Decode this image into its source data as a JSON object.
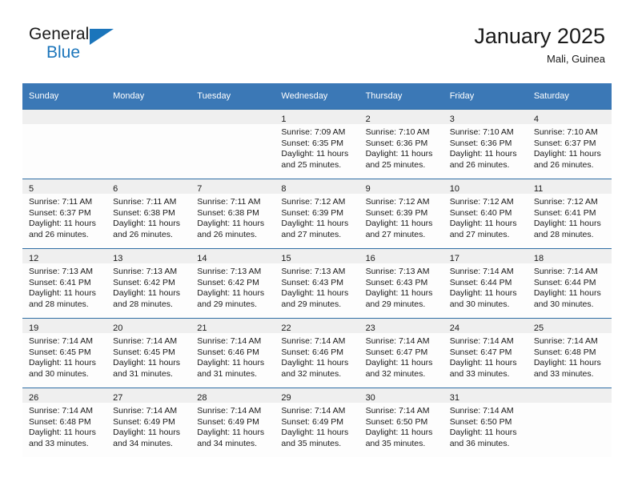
{
  "brand": {
    "word_top": "General",
    "word_bottom": "Blue",
    "logo_icon": "triangle-logo-icon",
    "accent_color": "#1b75bb"
  },
  "header": {
    "title": "January 2025",
    "subtitle": "Mali, Guinea"
  },
  "theme": {
    "header_blue": "#3b78b6",
    "header_rule": "#2e6da4",
    "daynum_band": "#efefef",
    "cell_bg": "#fdfdfd",
    "text": "#1a1a1a"
  },
  "weekday_headers": [
    "Sunday",
    "Monday",
    "Tuesday",
    "Wednesday",
    "Thursday",
    "Friday",
    "Saturday"
  ],
  "labels": {
    "sunrise": "Sunrise:",
    "sunset": "Sunset:",
    "daylight": "Daylight:"
  },
  "weeks": [
    [
      {
        "day": "",
        "l1": "",
        "l2": "",
        "l3": "",
        "l4": ""
      },
      {
        "day": "",
        "l1": "",
        "l2": "",
        "l3": "",
        "l4": ""
      },
      {
        "day": "",
        "l1": "",
        "l2": "",
        "l3": "",
        "l4": ""
      },
      {
        "day": "1",
        "l1": "Sunrise: 7:09 AM",
        "l2": "Sunset: 6:35 PM",
        "l3": "Daylight: 11 hours",
        "l4": "and 25 minutes."
      },
      {
        "day": "2",
        "l1": "Sunrise: 7:10 AM",
        "l2": "Sunset: 6:36 PM",
        "l3": "Daylight: 11 hours",
        "l4": "and 25 minutes."
      },
      {
        "day": "3",
        "l1": "Sunrise: 7:10 AM",
        "l2": "Sunset: 6:36 PM",
        "l3": "Daylight: 11 hours",
        "l4": "and 26 minutes."
      },
      {
        "day": "4",
        "l1": "Sunrise: 7:10 AM",
        "l2": "Sunset: 6:37 PM",
        "l3": "Daylight: 11 hours",
        "l4": "and 26 minutes."
      }
    ],
    [
      {
        "day": "5",
        "l1": "Sunrise: 7:11 AM",
        "l2": "Sunset: 6:37 PM",
        "l3": "Daylight: 11 hours",
        "l4": "and 26 minutes."
      },
      {
        "day": "6",
        "l1": "Sunrise: 7:11 AM",
        "l2": "Sunset: 6:38 PM",
        "l3": "Daylight: 11 hours",
        "l4": "and 26 minutes."
      },
      {
        "day": "7",
        "l1": "Sunrise: 7:11 AM",
        "l2": "Sunset: 6:38 PM",
        "l3": "Daylight: 11 hours",
        "l4": "and 26 minutes."
      },
      {
        "day": "8",
        "l1": "Sunrise: 7:12 AM",
        "l2": "Sunset: 6:39 PM",
        "l3": "Daylight: 11 hours",
        "l4": "and 27 minutes."
      },
      {
        "day": "9",
        "l1": "Sunrise: 7:12 AM",
        "l2": "Sunset: 6:39 PM",
        "l3": "Daylight: 11 hours",
        "l4": "and 27 minutes."
      },
      {
        "day": "10",
        "l1": "Sunrise: 7:12 AM",
        "l2": "Sunset: 6:40 PM",
        "l3": "Daylight: 11 hours",
        "l4": "and 27 minutes."
      },
      {
        "day": "11",
        "l1": "Sunrise: 7:12 AM",
        "l2": "Sunset: 6:41 PM",
        "l3": "Daylight: 11 hours",
        "l4": "and 28 minutes."
      }
    ],
    [
      {
        "day": "12",
        "l1": "Sunrise: 7:13 AM",
        "l2": "Sunset: 6:41 PM",
        "l3": "Daylight: 11 hours",
        "l4": "and 28 minutes."
      },
      {
        "day": "13",
        "l1": "Sunrise: 7:13 AM",
        "l2": "Sunset: 6:42 PM",
        "l3": "Daylight: 11 hours",
        "l4": "and 28 minutes."
      },
      {
        "day": "14",
        "l1": "Sunrise: 7:13 AM",
        "l2": "Sunset: 6:42 PM",
        "l3": "Daylight: 11 hours",
        "l4": "and 29 minutes."
      },
      {
        "day": "15",
        "l1": "Sunrise: 7:13 AM",
        "l2": "Sunset: 6:43 PM",
        "l3": "Daylight: 11 hours",
        "l4": "and 29 minutes."
      },
      {
        "day": "16",
        "l1": "Sunrise: 7:13 AM",
        "l2": "Sunset: 6:43 PM",
        "l3": "Daylight: 11 hours",
        "l4": "and 29 minutes."
      },
      {
        "day": "17",
        "l1": "Sunrise: 7:14 AM",
        "l2": "Sunset: 6:44 PM",
        "l3": "Daylight: 11 hours",
        "l4": "and 30 minutes."
      },
      {
        "day": "18",
        "l1": "Sunrise: 7:14 AM",
        "l2": "Sunset: 6:44 PM",
        "l3": "Daylight: 11 hours",
        "l4": "and 30 minutes."
      }
    ],
    [
      {
        "day": "19",
        "l1": "Sunrise: 7:14 AM",
        "l2": "Sunset: 6:45 PM",
        "l3": "Daylight: 11 hours",
        "l4": "and 30 minutes."
      },
      {
        "day": "20",
        "l1": "Sunrise: 7:14 AM",
        "l2": "Sunset: 6:45 PM",
        "l3": "Daylight: 11 hours",
        "l4": "and 31 minutes."
      },
      {
        "day": "21",
        "l1": "Sunrise: 7:14 AM",
        "l2": "Sunset: 6:46 PM",
        "l3": "Daylight: 11 hours",
        "l4": "and 31 minutes."
      },
      {
        "day": "22",
        "l1": "Sunrise: 7:14 AM",
        "l2": "Sunset: 6:46 PM",
        "l3": "Daylight: 11 hours",
        "l4": "and 32 minutes."
      },
      {
        "day": "23",
        "l1": "Sunrise: 7:14 AM",
        "l2": "Sunset: 6:47 PM",
        "l3": "Daylight: 11 hours",
        "l4": "and 32 minutes."
      },
      {
        "day": "24",
        "l1": "Sunrise: 7:14 AM",
        "l2": "Sunset: 6:47 PM",
        "l3": "Daylight: 11 hours",
        "l4": "and 33 minutes."
      },
      {
        "day": "25",
        "l1": "Sunrise: 7:14 AM",
        "l2": "Sunset: 6:48 PM",
        "l3": "Daylight: 11 hours",
        "l4": "and 33 minutes."
      }
    ],
    [
      {
        "day": "26",
        "l1": "Sunrise: 7:14 AM",
        "l2": "Sunset: 6:48 PM",
        "l3": "Daylight: 11 hours",
        "l4": "and 33 minutes."
      },
      {
        "day": "27",
        "l1": "Sunrise: 7:14 AM",
        "l2": "Sunset: 6:49 PM",
        "l3": "Daylight: 11 hours",
        "l4": "and 34 minutes."
      },
      {
        "day": "28",
        "l1": "Sunrise: 7:14 AM",
        "l2": "Sunset: 6:49 PM",
        "l3": "Daylight: 11 hours",
        "l4": "and 34 minutes."
      },
      {
        "day": "29",
        "l1": "Sunrise: 7:14 AM",
        "l2": "Sunset: 6:49 PM",
        "l3": "Daylight: 11 hours",
        "l4": "and 35 minutes."
      },
      {
        "day": "30",
        "l1": "Sunrise: 7:14 AM",
        "l2": "Sunset: 6:50 PM",
        "l3": "Daylight: 11 hours",
        "l4": "and 35 minutes."
      },
      {
        "day": "31",
        "l1": "Sunrise: 7:14 AM",
        "l2": "Sunset: 6:50 PM",
        "l3": "Daylight: 11 hours",
        "l4": "and 36 minutes."
      },
      {
        "day": "",
        "l1": "",
        "l2": "",
        "l3": "",
        "l4": ""
      }
    ]
  ]
}
